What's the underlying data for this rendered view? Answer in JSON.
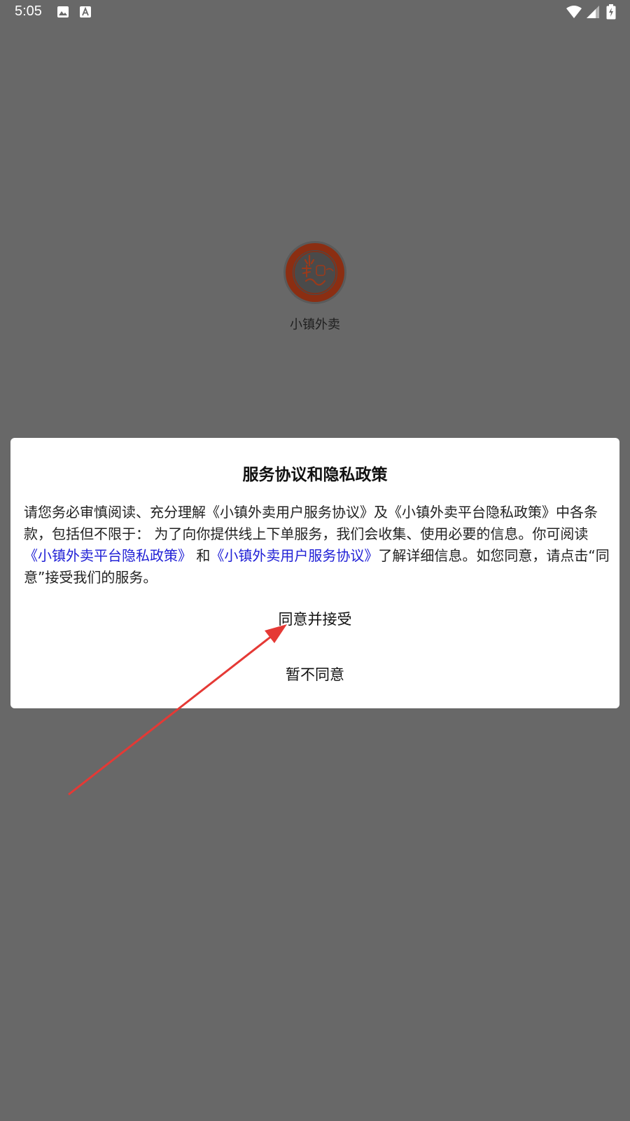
{
  "status_bar": {
    "time": "5:05",
    "icons": [
      "photo-icon",
      "a-text-icon",
      "wifi-icon",
      "signal-icon",
      "battery-icon"
    ]
  },
  "app": {
    "name": "小镇外卖",
    "logo_text": "小镇"
  },
  "dialog": {
    "title": "服务协议和隐私政策",
    "body": {
      "intro": "请您务必审慎阅读、充分理解《小镇外卖用户服务协议》及《小镇外卖平台隐私政策》中各条款，包括但不限于： 为了向你提供线上下单服务，我们会收集、使用必要的信息。你可阅读",
      "privacy_link": "《小镇外卖平台隐私政策》",
      "and_text": " 和",
      "service_link": "《小镇外卖用户服务协议》",
      "outro": "了解详细信息。如您同意，请点击“同意”接受我们的服务。"
    },
    "accept_label": "同意并接受",
    "decline_label": "暂不同意"
  },
  "colors": {
    "overlay_bg": "#686868",
    "dialog_bg": "#ffffff",
    "link": "#2121d6",
    "arrow": "#e53935",
    "logo_ring": "#8b2e12"
  }
}
